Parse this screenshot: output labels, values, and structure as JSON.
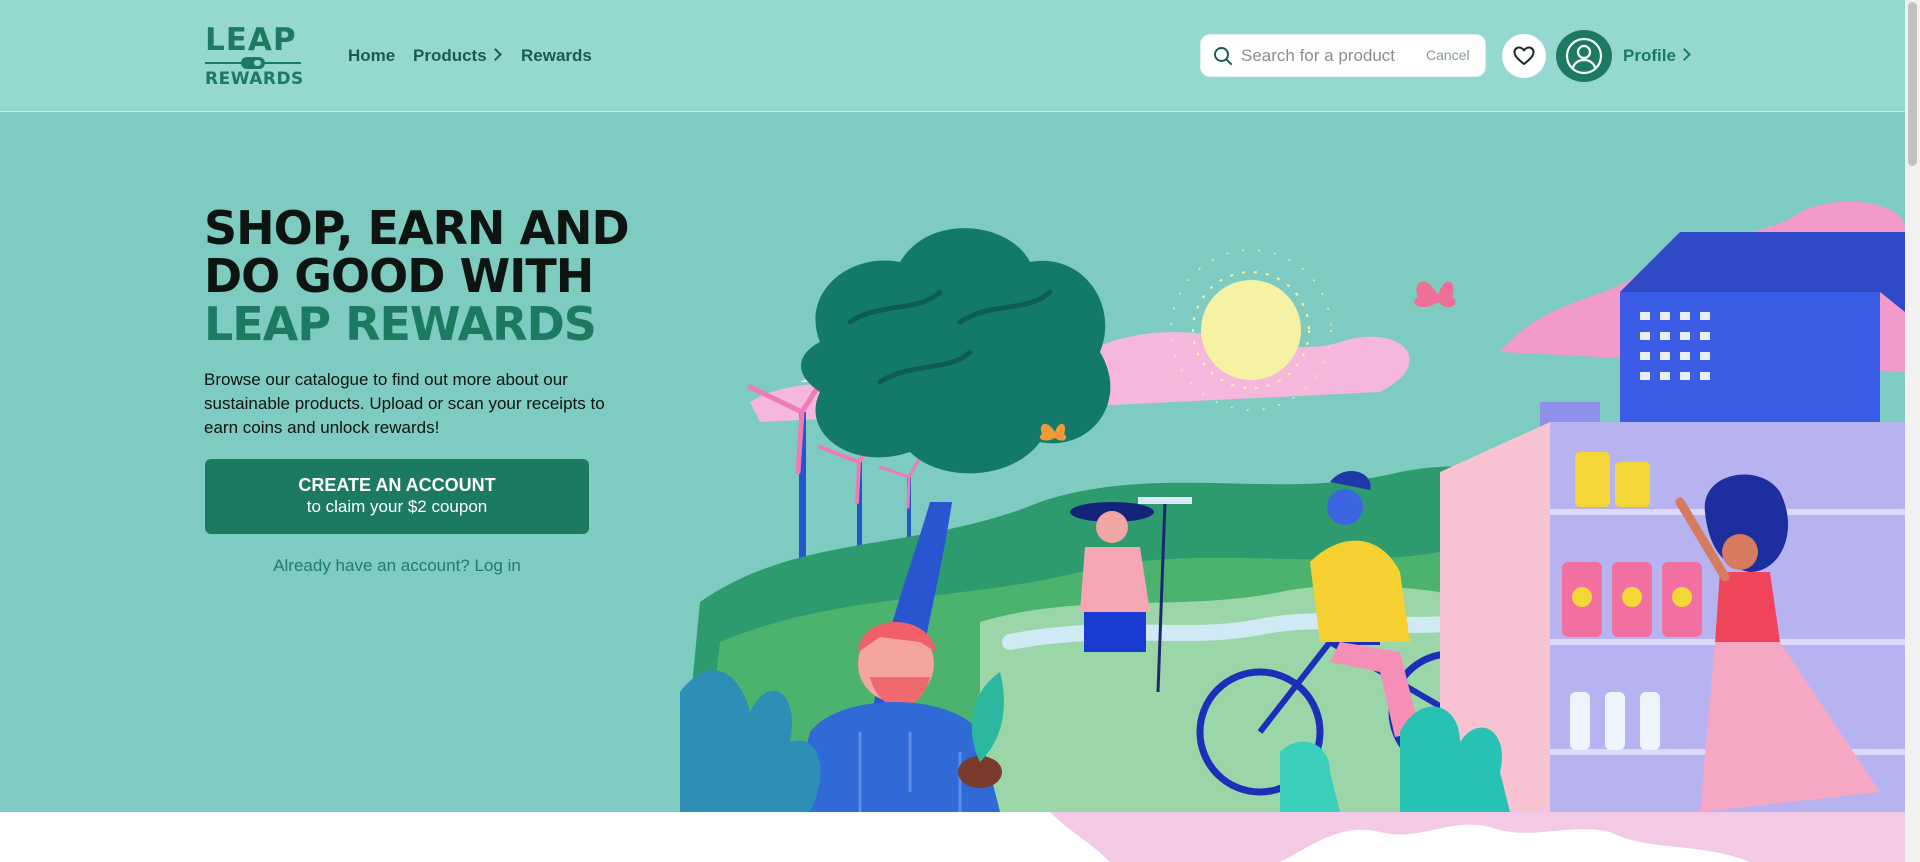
{
  "header": {
    "logo": {
      "line1": "LEAP",
      "line2": "REWARDS"
    },
    "nav": {
      "home": "Home",
      "products": "Products",
      "rewards": "Rewards"
    },
    "search": {
      "placeholder": "Search for a product",
      "cancel": "Cancel"
    },
    "profile": "Profile"
  },
  "hero": {
    "headline": [
      "SHOP, EARN AND",
      "DO GOOD WITH",
      "LEAP REWARDS"
    ],
    "description": "Browse our catalogue to find out more about our sustainable products. Upload or scan your receipts to earn coins and unlock rewards!",
    "cta": {
      "line1": "CREATE AN ACCOUNT",
      "line2": "to claim your $2 coupon"
    },
    "login": "Already have an account? Log in"
  },
  "colors": {
    "header_bg": "#94d8d0",
    "hero_bg": "#7ecbc1",
    "brand_green": "#1c7a63",
    "text_dark": "#0e1412"
  },
  "icons": [
    "search-icon",
    "heart-icon",
    "user-icon",
    "chevron-right-icon"
  ]
}
